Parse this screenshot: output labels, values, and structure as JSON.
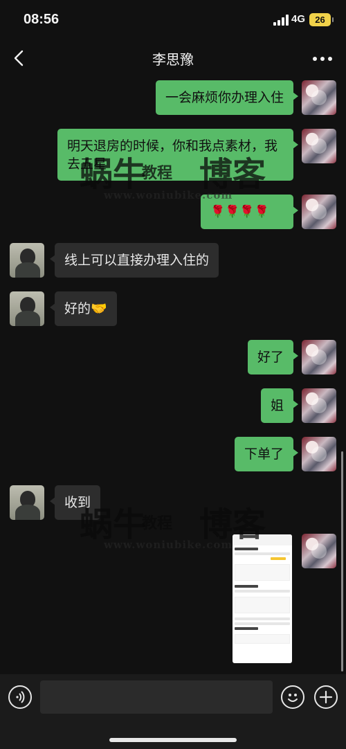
{
  "status_bar": {
    "time": "08:56",
    "network": "4G",
    "battery": "26"
  },
  "header": {
    "title": "李思豫"
  },
  "messages": [
    {
      "sender": "me",
      "text": "一会麻烦你办理入住"
    },
    {
      "sender": "me",
      "text": "明天退房的时候，你和我点素材，我去五星"
    },
    {
      "sender": "me",
      "text": "🌹🌹🌹🌹"
    },
    {
      "sender": "other",
      "text": "线上可以直接办理入住的"
    },
    {
      "sender": "other",
      "text": "好的🤝"
    },
    {
      "sender": "me",
      "text": "好了"
    },
    {
      "sender": "me",
      "text": "姐"
    },
    {
      "sender": "me",
      "text": "下单了"
    },
    {
      "sender": "other",
      "text": "收到"
    },
    {
      "sender": "me",
      "type": "image",
      "text": ""
    }
  ],
  "watermark": {
    "brand": "蜗牛",
    "middle": "教程",
    "blog": "博客",
    "url": "www.woniubike.com"
  },
  "input_bar": {
    "placeholder": ""
  },
  "colors": {
    "background": "#111111",
    "my_bubble": "#58bb68",
    "other_bubble": "#2d2d2d",
    "battery": "#f1d24a"
  }
}
